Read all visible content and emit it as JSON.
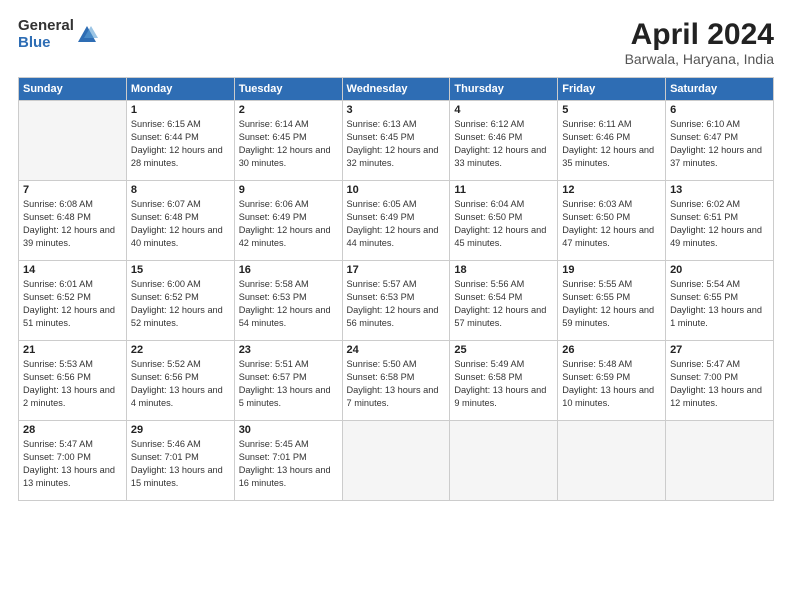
{
  "logo": {
    "general": "General",
    "blue": "Blue"
  },
  "title": "April 2024",
  "location": "Barwala, Haryana, India",
  "days_of_week": [
    "Sunday",
    "Monday",
    "Tuesday",
    "Wednesday",
    "Thursday",
    "Friday",
    "Saturday"
  ],
  "weeks": [
    [
      {
        "day": "",
        "empty": true
      },
      {
        "day": "1",
        "sunrise": "6:15 AM",
        "sunset": "6:44 PM",
        "daylight": "12 hours and 28 minutes."
      },
      {
        "day": "2",
        "sunrise": "6:14 AM",
        "sunset": "6:45 PM",
        "daylight": "12 hours and 30 minutes."
      },
      {
        "day": "3",
        "sunrise": "6:13 AM",
        "sunset": "6:45 PM",
        "daylight": "12 hours and 32 minutes."
      },
      {
        "day": "4",
        "sunrise": "6:12 AM",
        "sunset": "6:46 PM",
        "daylight": "12 hours and 33 minutes."
      },
      {
        "day": "5",
        "sunrise": "6:11 AM",
        "sunset": "6:46 PM",
        "daylight": "12 hours and 35 minutes."
      },
      {
        "day": "6",
        "sunrise": "6:10 AM",
        "sunset": "6:47 PM",
        "daylight": "12 hours and 37 minutes."
      }
    ],
    [
      {
        "day": "7",
        "sunrise": "6:08 AM",
        "sunset": "6:48 PM",
        "daylight": "12 hours and 39 minutes."
      },
      {
        "day": "8",
        "sunrise": "6:07 AM",
        "sunset": "6:48 PM",
        "daylight": "12 hours and 40 minutes."
      },
      {
        "day": "9",
        "sunrise": "6:06 AM",
        "sunset": "6:49 PM",
        "daylight": "12 hours and 42 minutes."
      },
      {
        "day": "10",
        "sunrise": "6:05 AM",
        "sunset": "6:49 PM",
        "daylight": "12 hours and 44 minutes."
      },
      {
        "day": "11",
        "sunrise": "6:04 AM",
        "sunset": "6:50 PM",
        "daylight": "12 hours and 45 minutes."
      },
      {
        "day": "12",
        "sunrise": "6:03 AM",
        "sunset": "6:50 PM",
        "daylight": "12 hours and 47 minutes."
      },
      {
        "day": "13",
        "sunrise": "6:02 AM",
        "sunset": "6:51 PM",
        "daylight": "12 hours and 49 minutes."
      }
    ],
    [
      {
        "day": "14",
        "sunrise": "6:01 AM",
        "sunset": "6:52 PM",
        "daylight": "12 hours and 51 minutes."
      },
      {
        "day": "15",
        "sunrise": "6:00 AM",
        "sunset": "6:52 PM",
        "daylight": "12 hours and 52 minutes."
      },
      {
        "day": "16",
        "sunrise": "5:58 AM",
        "sunset": "6:53 PM",
        "daylight": "12 hours and 54 minutes."
      },
      {
        "day": "17",
        "sunrise": "5:57 AM",
        "sunset": "6:53 PM",
        "daylight": "12 hours and 56 minutes."
      },
      {
        "day": "18",
        "sunrise": "5:56 AM",
        "sunset": "6:54 PM",
        "daylight": "12 hours and 57 minutes."
      },
      {
        "day": "19",
        "sunrise": "5:55 AM",
        "sunset": "6:55 PM",
        "daylight": "12 hours and 59 minutes."
      },
      {
        "day": "20",
        "sunrise": "5:54 AM",
        "sunset": "6:55 PM",
        "daylight": "13 hours and 1 minute."
      }
    ],
    [
      {
        "day": "21",
        "sunrise": "5:53 AM",
        "sunset": "6:56 PM",
        "daylight": "13 hours and 2 minutes."
      },
      {
        "day": "22",
        "sunrise": "5:52 AM",
        "sunset": "6:56 PM",
        "daylight": "13 hours and 4 minutes."
      },
      {
        "day": "23",
        "sunrise": "5:51 AM",
        "sunset": "6:57 PM",
        "daylight": "13 hours and 5 minutes."
      },
      {
        "day": "24",
        "sunrise": "5:50 AM",
        "sunset": "6:58 PM",
        "daylight": "13 hours and 7 minutes."
      },
      {
        "day": "25",
        "sunrise": "5:49 AM",
        "sunset": "6:58 PM",
        "daylight": "13 hours and 9 minutes."
      },
      {
        "day": "26",
        "sunrise": "5:48 AM",
        "sunset": "6:59 PM",
        "daylight": "13 hours and 10 minutes."
      },
      {
        "day": "27",
        "sunrise": "5:47 AM",
        "sunset": "7:00 PM",
        "daylight": "13 hours and 12 minutes."
      }
    ],
    [
      {
        "day": "28",
        "sunrise": "5:47 AM",
        "sunset": "7:00 PM",
        "daylight": "13 hours and 13 minutes."
      },
      {
        "day": "29",
        "sunrise": "5:46 AM",
        "sunset": "7:01 PM",
        "daylight": "13 hours and 15 minutes."
      },
      {
        "day": "30",
        "sunrise": "5:45 AM",
        "sunset": "7:01 PM",
        "daylight": "13 hours and 16 minutes."
      },
      {
        "day": "",
        "empty": true
      },
      {
        "day": "",
        "empty": true
      },
      {
        "day": "",
        "empty": true
      },
      {
        "day": "",
        "empty": true
      }
    ]
  ],
  "labels": {
    "sunrise_prefix": "Sunrise: ",
    "sunset_prefix": "Sunset: ",
    "daylight_prefix": "Daylight: "
  }
}
